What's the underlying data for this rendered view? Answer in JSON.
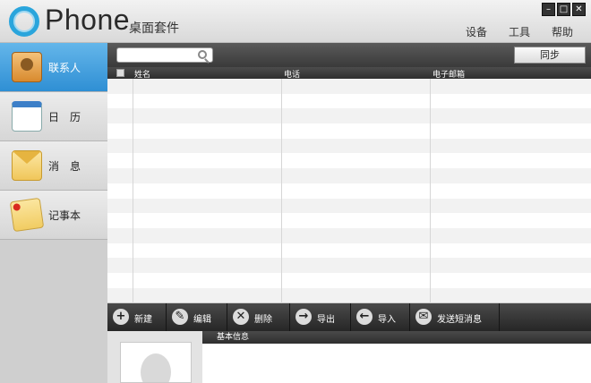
{
  "app": {
    "title": "Phone",
    "subtitle": "桌面套件"
  },
  "menu": {
    "items": [
      "设备",
      "工具",
      "帮助"
    ]
  },
  "window_controls": [
    "minimize-icon",
    "maximize-icon",
    "close-icon"
  ],
  "sidebar": {
    "items": [
      {
        "label": "联系人",
        "icon": "contacts-icon",
        "active": true
      },
      {
        "label": "日　历",
        "icon": "calendar-icon",
        "active": false
      },
      {
        "label": "消　息",
        "icon": "message-icon",
        "active": false
      },
      {
        "label": "记事本",
        "icon": "notes-icon",
        "active": false
      }
    ]
  },
  "toolbar": {
    "search_placeholder": "",
    "sync_label": "同步"
  },
  "table": {
    "columns": [
      "姓名",
      "电话",
      "电子邮箱"
    ],
    "rows": []
  },
  "actions": [
    {
      "label": "新建",
      "icon": "plus-icon"
    },
    {
      "label": "编辑",
      "icon": "wrench-icon"
    },
    {
      "label": "删除",
      "icon": "trash-icon"
    },
    {
      "label": "导出",
      "icon": "export-icon"
    },
    {
      "label": "导入",
      "icon": "import-icon"
    },
    {
      "label": "发送短消息",
      "icon": "sms-icon"
    }
  ],
  "detail": {
    "section_title": "基本信息"
  },
  "colors": {
    "accent": "#2f8fd4",
    "toolbar": "#3a3a3a"
  }
}
